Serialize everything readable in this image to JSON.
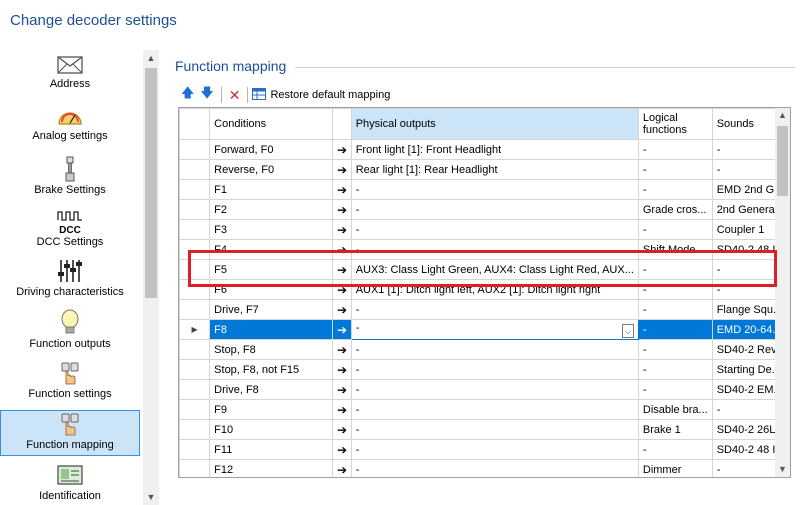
{
  "window": {
    "title": "Change decoder settings"
  },
  "nav": {
    "items": [
      {
        "id": "address",
        "label": "Address",
        "icon": "envelope-icon"
      },
      {
        "id": "analog",
        "label": "Analog settings",
        "icon": "gauge-icon"
      },
      {
        "id": "brake",
        "label": "Brake Settings",
        "icon": "brake-icon"
      },
      {
        "id": "dcc",
        "label": "DCC Settings",
        "icon": "dcc-icon",
        "icon_text": "DCC"
      },
      {
        "id": "driving",
        "label": "Driving characteristics",
        "icon": "sliders-icon"
      },
      {
        "id": "function-outputs",
        "label": "Function outputs",
        "icon": "bulb-icon"
      },
      {
        "id": "function-settings",
        "label": "Function settings",
        "icon": "hand-buttons-icon"
      },
      {
        "id": "function-mapping",
        "label": "Function mapping",
        "icon": "hand-buttons-icon",
        "selected": true
      },
      {
        "id": "identification",
        "label": "Identification",
        "icon": "id-card-icon"
      }
    ]
  },
  "group": {
    "title": "Function mapping"
  },
  "toolbar": {
    "up_icon": "arrow-up-icon",
    "down_icon": "arrow-down-icon",
    "delete_icon": "delete-icon",
    "restore_label": "Restore default mapping"
  },
  "grid": {
    "columns": [
      "Conditions",
      "",
      "Physical outputs",
      "Logical functions",
      "Sounds"
    ],
    "rows": [
      {
        "conditions": "Forward, F0",
        "arrow": "➔",
        "physical": "Front light [1]: Front Headlight",
        "logical": "-",
        "sounds": "-"
      },
      {
        "conditions": "Reverse, F0",
        "arrow": "➔",
        "physical": "Rear light [1]: Rear Headlight",
        "logical": "-",
        "sounds": "-"
      },
      {
        "conditions": "F1",
        "arrow": "➔",
        "physical": "-",
        "logical": "-",
        "sounds": "EMD 2nd G..."
      },
      {
        "conditions": "F2",
        "arrow": "➔",
        "physical": "-",
        "logical": "Grade cros...",
        "sounds": "2nd Genera..."
      },
      {
        "conditions": "F3",
        "arrow": "➔",
        "physical": "-",
        "logical": "-",
        "sounds": "Coupler 1"
      },
      {
        "conditions": "F4",
        "arrow": "➔",
        "physical": "-",
        "logical": "Shift Mode",
        "sounds": "SD40-2 48 I..."
      },
      {
        "conditions": "F5",
        "arrow": "➔",
        "physical": "AUX3: Class Light Green, AUX4: Class Light Red, AUX...",
        "logical": "-",
        "sounds": "-"
      },
      {
        "conditions": "F6",
        "arrow": "➔",
        "physical": "AUX1 [1]: Ditch light left, AUX2 [1]: Ditch light right",
        "logical": "-",
        "sounds": "-"
      },
      {
        "conditions": "Drive, F7",
        "arrow": "➔",
        "physical": "-",
        "logical": "-",
        "sounds": "Flange Squ..."
      },
      {
        "conditions": "F8",
        "arrow": "➔",
        "physical": "-",
        "logical": "-",
        "sounds": "EMD 20-64...",
        "selected": true
      },
      {
        "conditions": "Stop, F8",
        "arrow": "➔",
        "physical": "-",
        "logical": "-",
        "sounds": "SD40-2 Rev..."
      },
      {
        "conditions": "Stop, F8, not F15",
        "arrow": "➔",
        "physical": "-",
        "logical": "-",
        "sounds": "Starting De..."
      },
      {
        "conditions": "Drive, F8",
        "arrow": "➔",
        "physical": "-",
        "logical": "-",
        "sounds": "SD40-2 EM..."
      },
      {
        "conditions": "F9",
        "arrow": "➔",
        "physical": "-",
        "logical": "Disable bra...",
        "sounds": "-"
      },
      {
        "conditions": "F10",
        "arrow": "➔",
        "physical": "-",
        "logical": "Brake 1",
        "sounds": "SD40-2 26L..."
      },
      {
        "conditions": "F11",
        "arrow": "➔",
        "physical": "-",
        "logical": "-",
        "sounds": "SD40-2 48 I..."
      },
      {
        "conditions": "F12",
        "arrow": "➔",
        "physical": "-",
        "logical": "Dimmer",
        "sounds": "-"
      }
    ]
  },
  "colors": {
    "title": "#1e4f96",
    "selection": "#0078d7",
    "highlight": "#e01e24",
    "nav_selected": "#cce4f7"
  }
}
